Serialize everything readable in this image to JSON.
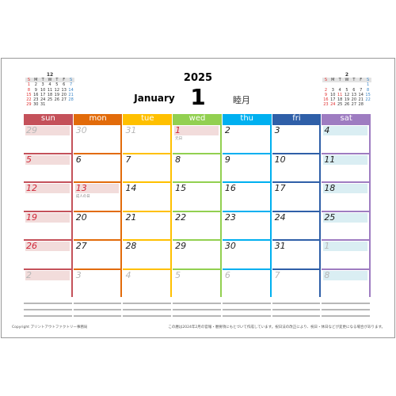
{
  "header": {
    "year": "2025",
    "month_en": "January",
    "month_num": "1",
    "month_jp": "睦月"
  },
  "colors": {
    "sun": "#c4515a",
    "mon": "#e26b0a",
    "tue": "#ffc000",
    "wed": "#92d050",
    "thu": "#00b0f0",
    "fri": "#2f5fa8",
    "sat": "#9e7cc1",
    "holiday_bg": "#f2dcdb",
    "saturday_bg": "#daeef3"
  },
  "weekdays": [
    "sun",
    "mon",
    "tue",
    "wed",
    "thu",
    "fri",
    "sat"
  ],
  "weeks": [
    [
      {
        "d": "29",
        "t": "sun-out"
      },
      {
        "d": "30",
        "t": "out"
      },
      {
        "d": "31",
        "t": "out"
      },
      {
        "d": "1",
        "t": "holiday",
        "h": "元日"
      },
      {
        "d": "2",
        "t": ""
      },
      {
        "d": "3",
        "t": ""
      },
      {
        "d": "4",
        "t": "sat"
      }
    ],
    [
      {
        "d": "5",
        "t": "sun"
      },
      {
        "d": "6",
        "t": ""
      },
      {
        "d": "7",
        "t": ""
      },
      {
        "d": "8",
        "t": ""
      },
      {
        "d": "9",
        "t": ""
      },
      {
        "d": "10",
        "t": ""
      },
      {
        "d": "11",
        "t": "sat"
      }
    ],
    [
      {
        "d": "12",
        "t": "sun"
      },
      {
        "d": "13",
        "t": "holiday",
        "h": "成人の日"
      },
      {
        "d": "14",
        "t": ""
      },
      {
        "d": "15",
        "t": ""
      },
      {
        "d": "16",
        "t": ""
      },
      {
        "d": "17",
        "t": ""
      },
      {
        "d": "18",
        "t": "sat"
      }
    ],
    [
      {
        "d": "19",
        "t": "sun"
      },
      {
        "d": "20",
        "t": ""
      },
      {
        "d": "21",
        "t": ""
      },
      {
        "d": "22",
        "t": ""
      },
      {
        "d": "23",
        "t": ""
      },
      {
        "d": "24",
        "t": ""
      },
      {
        "d": "25",
        "t": "sat"
      }
    ],
    [
      {
        "d": "26",
        "t": "sun"
      },
      {
        "d": "27",
        "t": ""
      },
      {
        "d": "28",
        "t": ""
      },
      {
        "d": "29",
        "t": ""
      },
      {
        "d": "30",
        "t": ""
      },
      {
        "d": "31",
        "t": ""
      },
      {
        "d": "1",
        "t": "sat-out"
      }
    ],
    [
      {
        "d": "2",
        "t": "sun-out"
      },
      {
        "d": "3",
        "t": "out"
      },
      {
        "d": "4",
        "t": "out"
      },
      {
        "d": "5",
        "t": "out"
      },
      {
        "d": "6",
        "t": "out"
      },
      {
        "d": "7",
        "t": "out"
      },
      {
        "d": "8",
        "t": "sat-out"
      }
    ]
  ],
  "mini_prev": {
    "title": "12",
    "head": [
      "S",
      "M",
      "T",
      "W",
      "T",
      "F",
      "S"
    ],
    "rows": [
      [
        "1",
        "2",
        "3",
        "4",
        "5",
        "6",
        "7"
      ],
      [
        "8",
        "9",
        "10",
        "11",
        "12",
        "13",
        "14"
      ],
      [
        "15",
        "16",
        "17",
        "18",
        "19",
        "20",
        "21"
      ],
      [
        "22",
        "23",
        "24",
        "25",
        "26",
        "27",
        "28"
      ],
      [
        "29",
        "30",
        "31",
        "",
        "",
        "",
        ""
      ]
    ],
    "red_extra": []
  },
  "mini_next": {
    "title": "2",
    "head": [
      "S",
      "M",
      "T",
      "W",
      "T",
      "F",
      "S"
    ],
    "rows": [
      [
        "",
        "",
        "",
        "",
        "",
        "",
        "1"
      ],
      [
        "2",
        "3",
        "4",
        "5",
        "6",
        "7",
        "8"
      ],
      [
        "9",
        "10",
        "11",
        "12",
        "13",
        "14",
        "15"
      ],
      [
        "16",
        "17",
        "18",
        "19",
        "20",
        "21",
        "22"
      ],
      [
        "23",
        "24",
        "25",
        "26",
        "27",
        "28",
        ""
      ]
    ],
    "red_extra": [
      "11",
      "24"
    ]
  },
  "footer": {
    "copyright": "Copyright プリントアウトファクトリー事務局",
    "disclaimer": "この暦は2024年2月の官報・暦要項にもとづいて作成しています。祝日法の改正により、祝日・休日などが変更になる場合があります。"
  }
}
